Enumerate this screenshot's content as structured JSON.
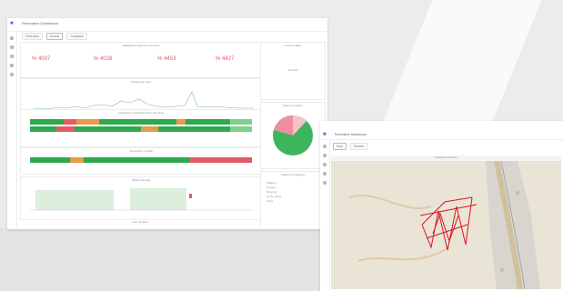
{
  "dashboard": {
    "title": "Recreation Dashboard",
    "tabs": [
      "Overview",
      "Details",
      "Compare"
    ],
    "stats_title": "Statistics of visitors in the area",
    "stats": [
      "% 4037",
      "% 4028",
      "% 4453",
      "% 4427"
    ],
    "spark_title": "Visitors per hour",
    "bars1_title": "Occupancy of parking lots in the area",
    "bars2_title": "Occupancy of trails",
    "area_title": "Visitors per day",
    "right_top_title": "Current value",
    "right_top_value": "No data",
    "pie_title": "Share of visitors",
    "list_title": "Visitors by category",
    "list_items": [
      "Walking",
      "Cycling",
      "Running",
      "Horse riding",
      "Other"
    ],
    "footer": "Last updated"
  },
  "map_window": {
    "title": "Recreation Dashboard",
    "tabs": [
      "Map",
      "Routes"
    ],
    "map_title": "Heatmap of routes"
  },
  "colors": {
    "green": "#2fa84f",
    "red": "#e35b66",
    "orange": "#e59b4a",
    "pie_green": "#3fb45f",
    "pie_pink": "#ef8f9e",
    "route_red": "#d8141e"
  },
  "icons": {
    "apps": "apps-icon"
  }
}
